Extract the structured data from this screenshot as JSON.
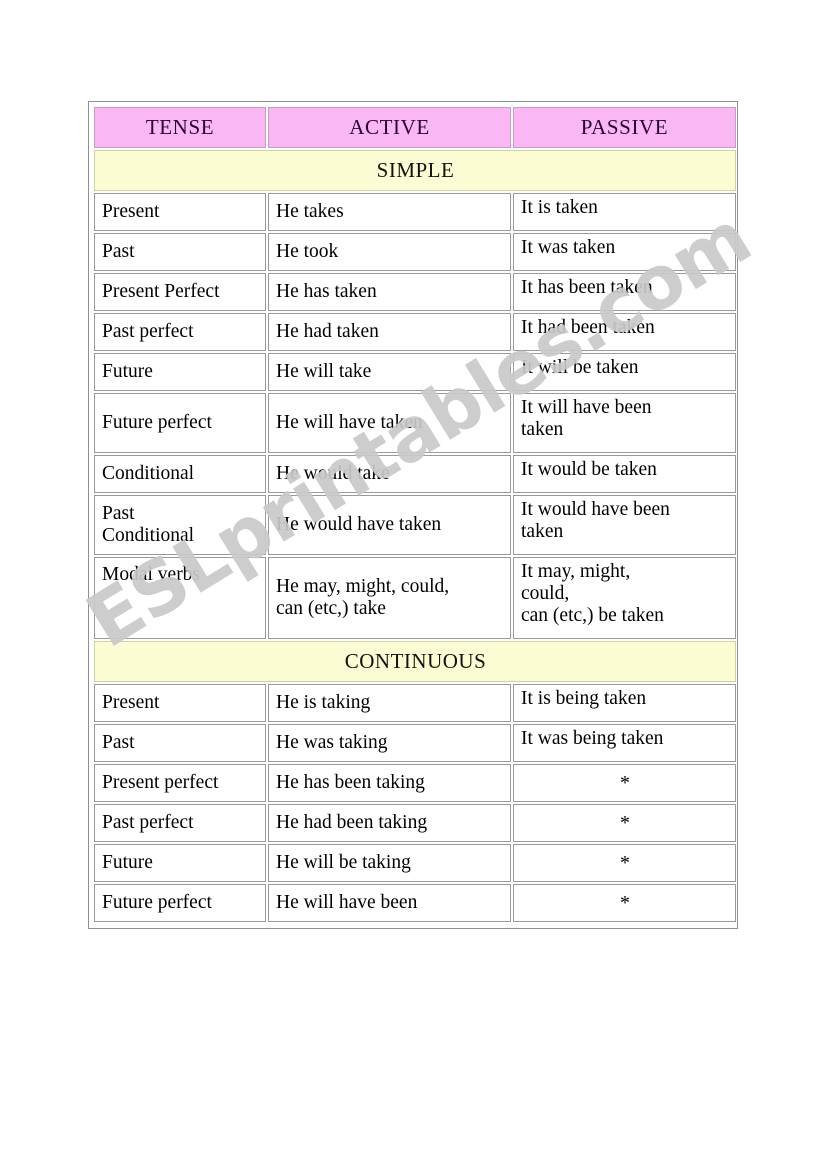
{
  "page": {
    "background_color": "#ffffff",
    "watermark_text": "ESLprintables.com",
    "watermark_color": "#c9c9c9"
  },
  "table": {
    "accent_header_color": "#f9b8f4",
    "accent_section_color": "#fbfbd4",
    "border_color": "#9a9a9a",
    "headers": [
      {
        "label": "TENSE"
      },
      {
        "label": "ACTIVE"
      },
      {
        "label": "PASSIVE"
      }
    ],
    "sections": [
      {
        "title": "SIMPLE",
        "rows": [
          {
            "tense": "Present",
            "active": "He takes",
            "passive": "It is taken"
          },
          {
            "tense": "Past",
            "active": "He took",
            "passive": "It was taken"
          },
          {
            "tense": "Present Perfect",
            "active": "He has taken",
            "passive": "It has been taken"
          },
          {
            "tense": "Past perfect",
            "active": "He had taken",
            "passive": "It had been taken"
          },
          {
            "tense": "Future",
            "active": "He will take",
            "passive": "It will be taken"
          },
          {
            "tense": "Future perfect",
            "active": "He will have taken",
            "passive_l1": "It will have been",
            "passive_l2": "taken"
          },
          {
            "tense": "Conditional",
            "active": "He would take",
            "passive": "It would be taken"
          },
          {
            "tense_l1": "Past",
            "tense_l2": "Conditional",
            "active": "He would have taken",
            "passive_l1": "It would have been",
            "passive_l2": "taken"
          },
          {
            "tense": "Modal verbs",
            "active_l1": "He may, might, could,",
            "active_l2": "can (etc,) take",
            "passive_l1": "It may, might,",
            "passive_l2": "could,",
            "passive_l3": "can (etc,) be taken"
          }
        ]
      },
      {
        "title": "CONTINUOUS",
        "rows": [
          {
            "tense": "Present",
            "active": "He is taking",
            "passive": "It is being taken"
          },
          {
            "tense": "Past",
            "active": "He was taking",
            "passive": "It was being taken"
          },
          {
            "tense": "Present perfect",
            "active": "He has been taking",
            "passive": "*"
          },
          {
            "tense": "Past perfect",
            "active": "He had been taking",
            "passive": "*"
          },
          {
            "tense": "Future",
            "active": "He will be taking",
            "passive": "*"
          },
          {
            "tense": "Future perfect",
            "active": "He will have been",
            "passive": "*"
          }
        ]
      }
    ]
  }
}
